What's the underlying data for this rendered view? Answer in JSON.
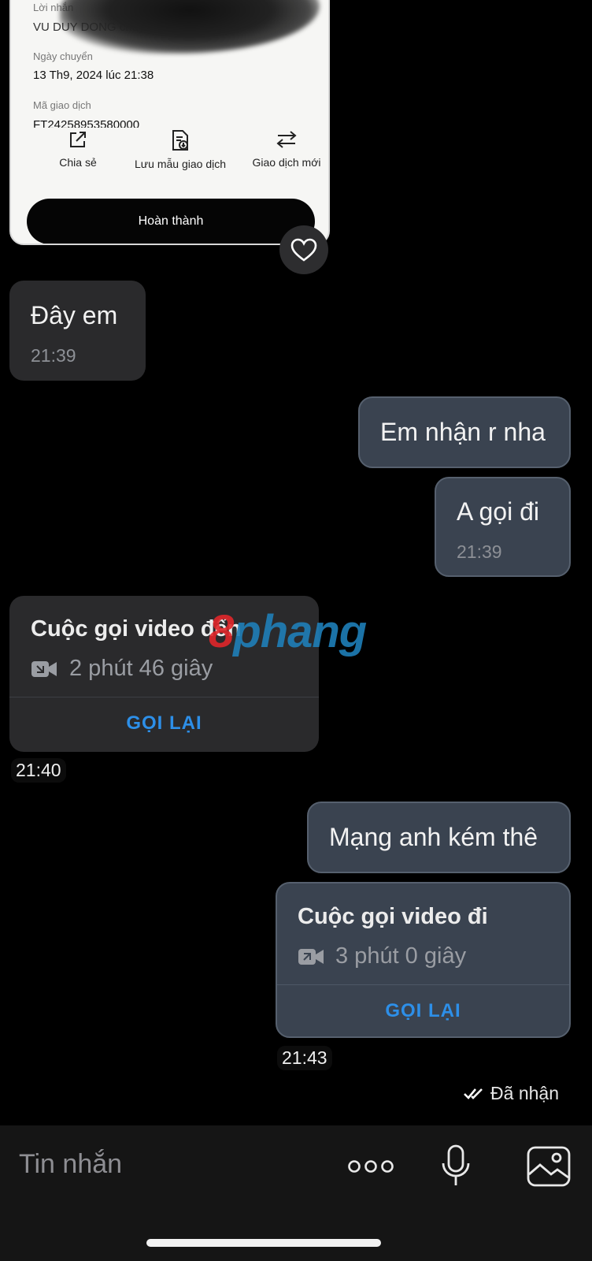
{
  "receipt": {
    "message_label": "Lời nhắn",
    "message_value": "VU DUY DONG chuyen",
    "date_label": "Ngày chuyển",
    "date_value": "13 Th9, 2024 lúc 21:38",
    "txn_label": "Mã giao dịch",
    "txn_value": "FT24258953580000",
    "actions": [
      {
        "label": "Chia sẻ",
        "icon": "share-icon"
      },
      {
        "label": "Lưu mẫu giao dịch",
        "icon": "save-template-icon"
      },
      {
        "label": "Giao dịch mới",
        "icon": "swap-icon"
      }
    ],
    "done_label": "Hoàn thành"
  },
  "messages": [
    {
      "direction": "in",
      "text": "Đây em",
      "time": "21:39"
    },
    {
      "direction": "out",
      "text": "Em nhận r nha"
    },
    {
      "direction": "out",
      "text": "A gọi đi",
      "time": "21:39"
    },
    {
      "direction": "out",
      "text": "Mạng anh kém thê"
    }
  ],
  "calls": [
    {
      "direction": "in",
      "title": "Cuộc gọi video đến",
      "duration": "2 phút 46 giây",
      "action": "GỌI LẠI",
      "time": "21:40"
    },
    {
      "direction": "out",
      "title": "Cuộc gọi video đi",
      "duration": "3 phút 0 giây",
      "action": "GỌI LẠI",
      "time": "21:43"
    }
  ],
  "watermark": {
    "part1": "8",
    "part2": "phang"
  },
  "status": {
    "text": "Đã nhận",
    "icon": "double-check-icon"
  },
  "composer": {
    "placeholder": "Tin nhắn",
    "icons": [
      "more-icon",
      "microphone-icon",
      "image-icon"
    ]
  },
  "colors": {
    "background": "#000000",
    "incoming_bubble": "#2a2a2c",
    "outgoing_bubble": "#3a4350",
    "link": "#2d8fe8"
  }
}
